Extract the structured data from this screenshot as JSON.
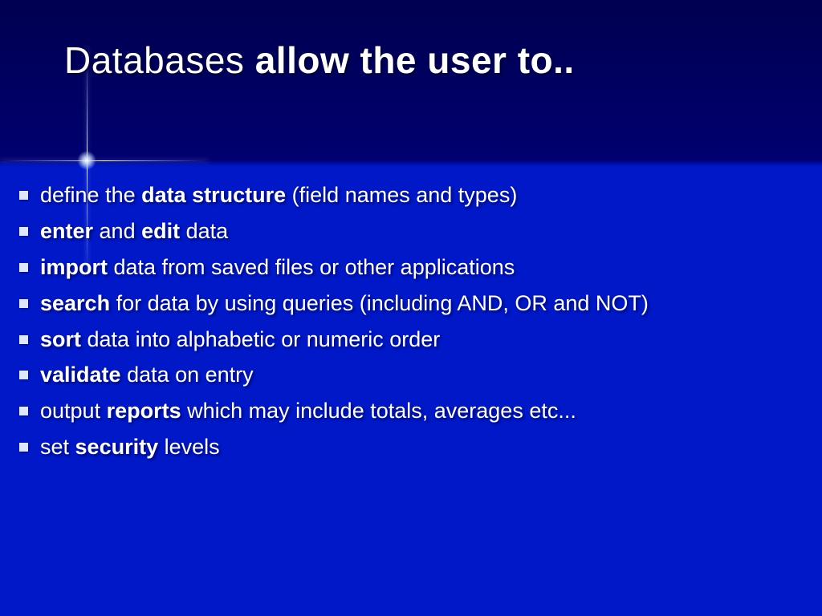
{
  "title": {
    "part1": "Databases ",
    "part2": "allow the user to.."
  },
  "bullets": [
    {
      "html": "define the <b>data structure</b> (field names and types)"
    },
    {
      "html": "<b>enter</b> and <b>edit</b> data"
    },
    {
      "html": "<b>import</b> data from saved files or other applications"
    },
    {
      "html": "<b>search</b> for data by using queries (including AND, OR and NOT)"
    },
    {
      "html": "<b>sort</b> data into alphabetic or numeric order"
    },
    {
      "html": "<b>validate</b> data on entry"
    },
    {
      "html": "output <b>reports</b> which may include totals, averages etc..."
    },
    {
      "html": "set <b>security</b> levels"
    }
  ]
}
